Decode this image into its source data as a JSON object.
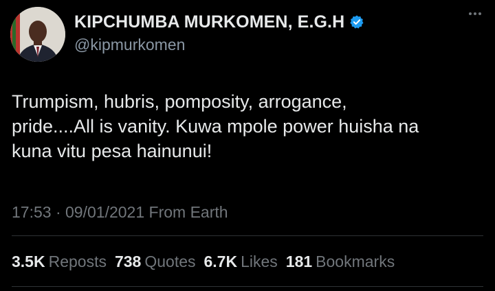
{
  "author": {
    "name": "KIPCHUMBA MURKOMEN, E.G.H",
    "handle": "@kipmurkomen",
    "verified": true,
    "avatar_icon": "profile-photo"
  },
  "post": {
    "text": "Trumpism, hubris, pomposity, arrogance,\npride....All is vanity. Kuwa mpole power huisha na\nkuna vitu pesa hainunui!",
    "time": "17:53",
    "separator": "·",
    "date": "09/01/2021",
    "source": "From Earth"
  },
  "stats": [
    {
      "count": "3.5K",
      "label": "Reposts"
    },
    {
      "count": "738",
      "label": "Quotes"
    },
    {
      "count": "6.7K",
      "label": "Likes"
    },
    {
      "count": "181",
      "label": "Bookmarks"
    }
  ],
  "colors": {
    "background": "#000000",
    "text": "#e7e9ea",
    "secondary": "#71767b",
    "verified": "#1d9bf0"
  }
}
